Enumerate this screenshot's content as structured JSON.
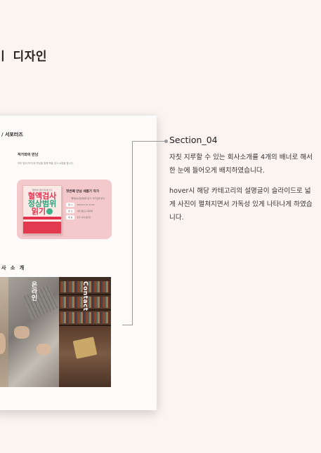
{
  "page": {
    "heading": "ㅣ 디자인"
  },
  "mockup": {
    "section_label": "/ 서포터즈",
    "subtitle": "작가와의 만남",
    "description": "여러 명사(작가)와 만남을 통해 책을 읽고 소통을 합니다.",
    "event_card": {
      "book_tag": "혈액검사 결과 한눈에 보기",
      "book_title_line1": "혈액검사",
      "book_title_line2": "정상범위",
      "book_title_line3": "읽기",
      "title": "첫번째 만남 세름기 작가",
      "intro": "'혈액검사정상범위 읽기' 작가님을 만나",
      "rows": [
        {
          "chip": "일 시",
          "text": "2023.07.07 14:00"
        },
        {
          "chip": "장 소",
          "text": "서울 종로구 북카페"
        },
        {
          "chip": "대 상",
          "text": "한국 사회 청년들"
        }
      ]
    },
    "about_title": "사 소 개",
    "photo_labels": [
      "온라인",
      "Contact"
    ]
  },
  "section": {
    "title": "Section_04",
    "paragraph1": "자칫 지루할 수 있는 회사소개를 4개의 배너로 해서 한 눈에  들어오게 배치하였습니다.",
    "paragraph2": "hover시 해당 카테고리의 설명글이 슬라이드로 넓게 사진이 펼쳐지면서 가독성 있게  나타나게 하였습니다."
  }
}
